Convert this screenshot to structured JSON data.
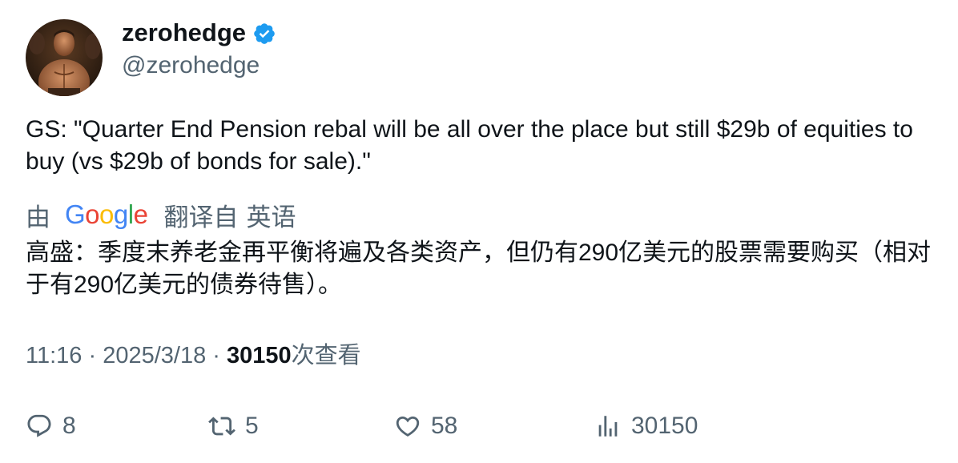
{
  "author": {
    "display_name": "zerohedge",
    "handle": "@zerohedge",
    "verified": true
  },
  "tweet": {
    "text": "GS: \"Quarter End Pension rebal will be all over the place but still $29b of equities to buy (vs $29b of bonds for sale).\"",
    "translation_prefix": "由",
    "translation_provider": "Google",
    "translation_suffix": "翻译自",
    "translation_source_lang": "英语",
    "translated_text": "高盛：季度末养老金再平衡将遍及各类资产，但仍有290亿美元的股票需要购买（相对于有290亿美元的债券待售）。"
  },
  "meta": {
    "time": "11:16",
    "separator": "·",
    "date": "2025/3/18",
    "views_count": "30150",
    "views_label": "次查看"
  },
  "actions": {
    "replies": "8",
    "retweets": "5",
    "likes": "58",
    "views": "30150"
  },
  "colors": {
    "text_primary": "#0f1419",
    "text_secondary": "#536471",
    "verified_blue": "#1d9bf0"
  }
}
